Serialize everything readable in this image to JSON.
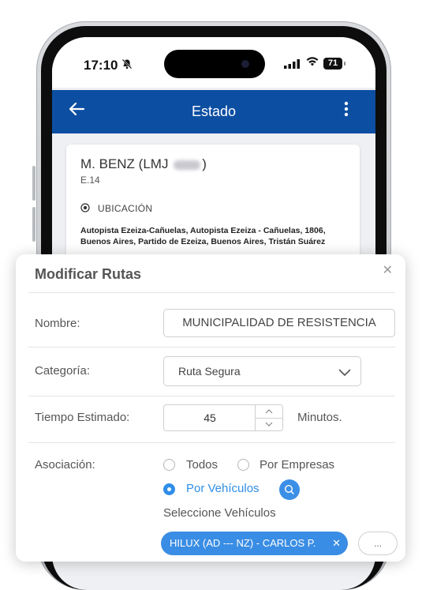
{
  "status_bar": {
    "time": "17:10",
    "battery": "71"
  },
  "app_bar": {
    "title": "Estado"
  },
  "vehicle_card": {
    "name_prefix": "M. BENZ (LMJ",
    "name_suffix": ")",
    "code": "E.14",
    "location_label": "UBICACIÓN",
    "address": "Autopista Ezeiza-Cañuelas, Autopista Ezeiza - Cañuelas, 1806, Buenos Aires, Partido de Ezeiza, Buenos Aires, Tristán Suárez"
  },
  "modal": {
    "title": "Modificar Rutas",
    "close": "✕",
    "name_label": "Nombre:",
    "name_value": "MUNICIPALIDAD DE RESISTENCIA",
    "category_label": "Categoría:",
    "category_value": "Ruta Segura",
    "time_label": "Tiempo Estimado:",
    "time_value": "45",
    "time_unit": "Minutos.",
    "association_label": "Asociación:",
    "association_options": {
      "all": "Todos",
      "by_company": "Por Empresas",
      "by_vehicle": "Por Vehículos"
    },
    "association_selected": "Por Vehículos",
    "select_vehicles_label": "Seleccione Vehículos",
    "selected_vehicle_chip": "HILUX (AD --- NZ) - CARLOS P.",
    "more_button": "..."
  },
  "colors": {
    "primary": "#0c4ea2",
    "accent": "#3a8de4"
  }
}
